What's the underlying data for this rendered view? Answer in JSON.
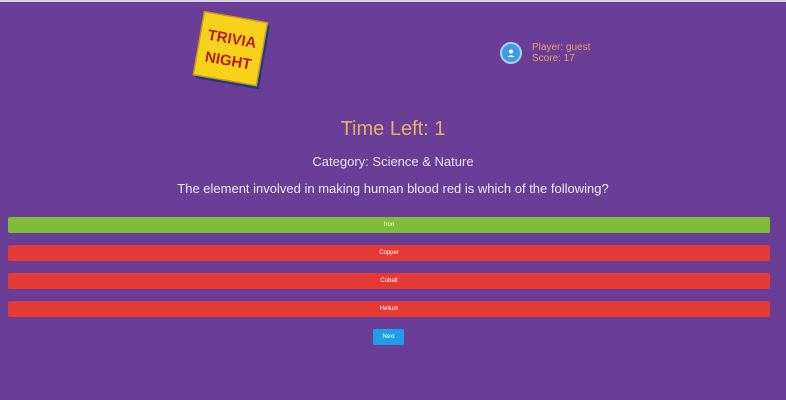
{
  "logo": {
    "line1": "TRIVIA",
    "line2": "NIGHT"
  },
  "player": {
    "name": "Player: guest",
    "score": "Score: 17"
  },
  "timer": {
    "text": "Time Left: 1"
  },
  "question": {
    "category": "Category: Science & Nature",
    "text": "The element involved in making human blood red is which of the following?"
  },
  "answers": [
    {
      "label": "Iron",
      "state": "correct"
    },
    {
      "label": "Copper",
      "state": "wrong"
    },
    {
      "label": "Cobalt",
      "state": "wrong"
    },
    {
      "label": "Helium",
      "state": "wrong"
    }
  ],
  "next_label": "Next",
  "colors": {
    "background": "#6a3d96",
    "correct": "#7cbd3a",
    "wrong": "#e53935",
    "accent": "#1e9ee8",
    "timer": "#e3b06b"
  }
}
